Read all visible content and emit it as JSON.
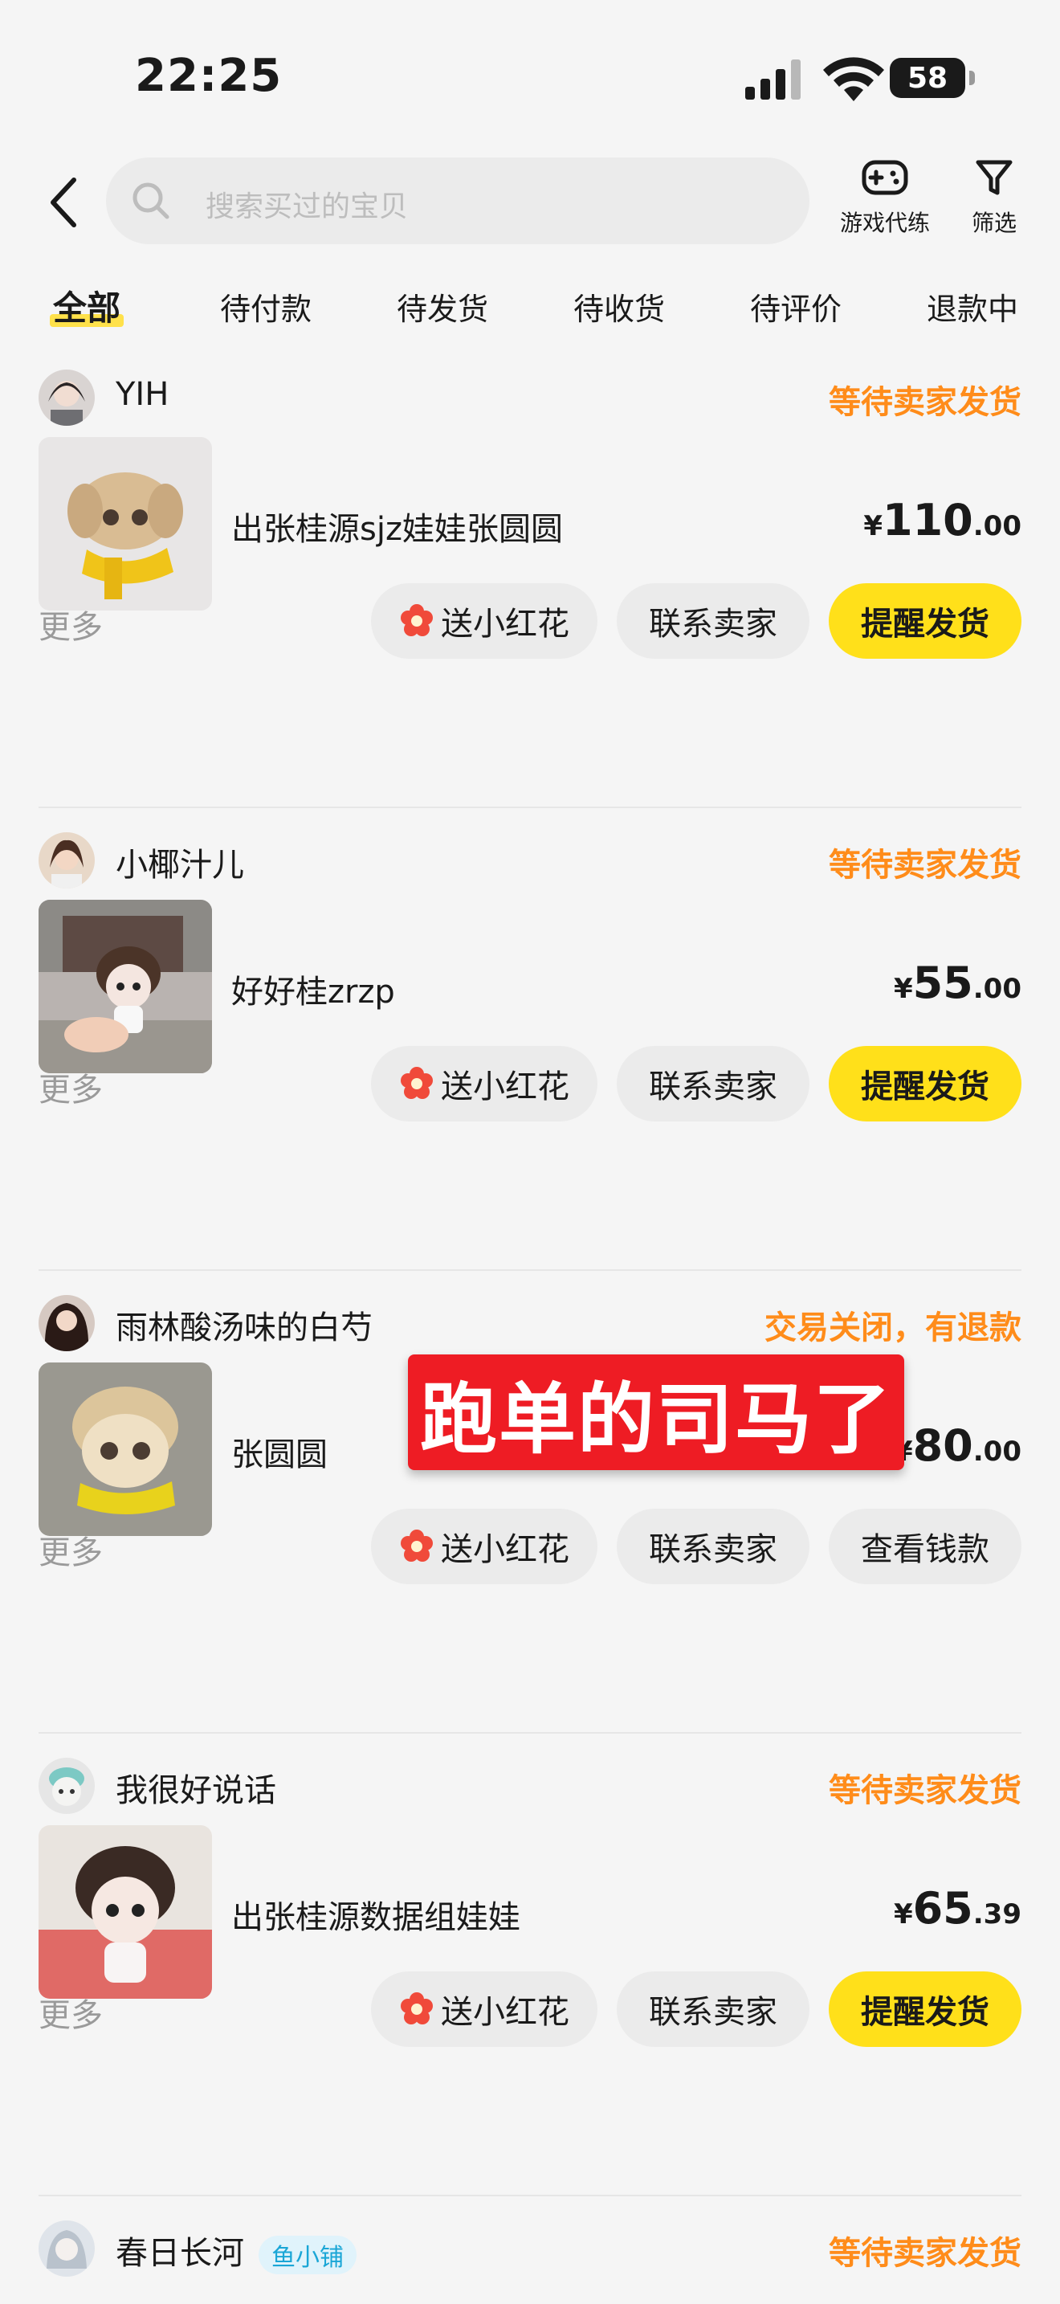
{
  "status_bar": {
    "time": "22:25",
    "battery": "58"
  },
  "header": {
    "search_placeholder": "搜索买过的宝贝",
    "game_label": "游戏代练",
    "filter_label": "筛选"
  },
  "tabs": [
    "全部",
    "待付款",
    "待发货",
    "待收货",
    "待评价",
    "退款中"
  ],
  "active_tab": "全部",
  "orders": [
    {
      "seller": "YIH",
      "status": "等待卖家发货",
      "title": "出张桂源sjz娃娃张圆圆",
      "price_currency": "¥",
      "price_int": "110",
      "price_dec": ".00",
      "more": "更多",
      "btn_flower": "送小红花",
      "btn_contact": "联系卖家",
      "btn_action": "提醒发货"
    },
    {
      "seller": "小椰汁儿",
      "status": "等待卖家发货",
      "title": "好好桂zrzp",
      "price_currency": "¥",
      "price_int": "55",
      "price_dec": ".00",
      "more": "更多",
      "btn_flower": "送小红花",
      "btn_contact": "联系卖家",
      "btn_action": "提醒发货"
    },
    {
      "seller": "雨林酸汤味的白芍",
      "status": "交易关闭，有退款",
      "title": "张圆圆",
      "price_currency": "¥",
      "price_int": "80",
      "price_dec": ".00",
      "more": "更多",
      "btn_flower": "送小红花",
      "btn_contact": "联系卖家",
      "btn_action": "查看钱款"
    },
    {
      "seller": "我很好说话",
      "status": "等待卖家发货",
      "title": "出张桂源数据组娃娃",
      "price_currency": "¥",
      "price_int": "65",
      "price_dec": ".39",
      "more": "更多",
      "btn_flower": "送小红花",
      "btn_contact": "联系卖家",
      "btn_action": "提醒发货"
    },
    {
      "seller": "春日长河",
      "badge": "鱼小铺",
      "status": "等待卖家发货"
    }
  ],
  "sticker_text": "跑单的司马了",
  "colors": {
    "accent_yellow": "#ffe01a",
    "status_orange": "#ff8c1a",
    "sticker_red": "#ee1c24"
  }
}
